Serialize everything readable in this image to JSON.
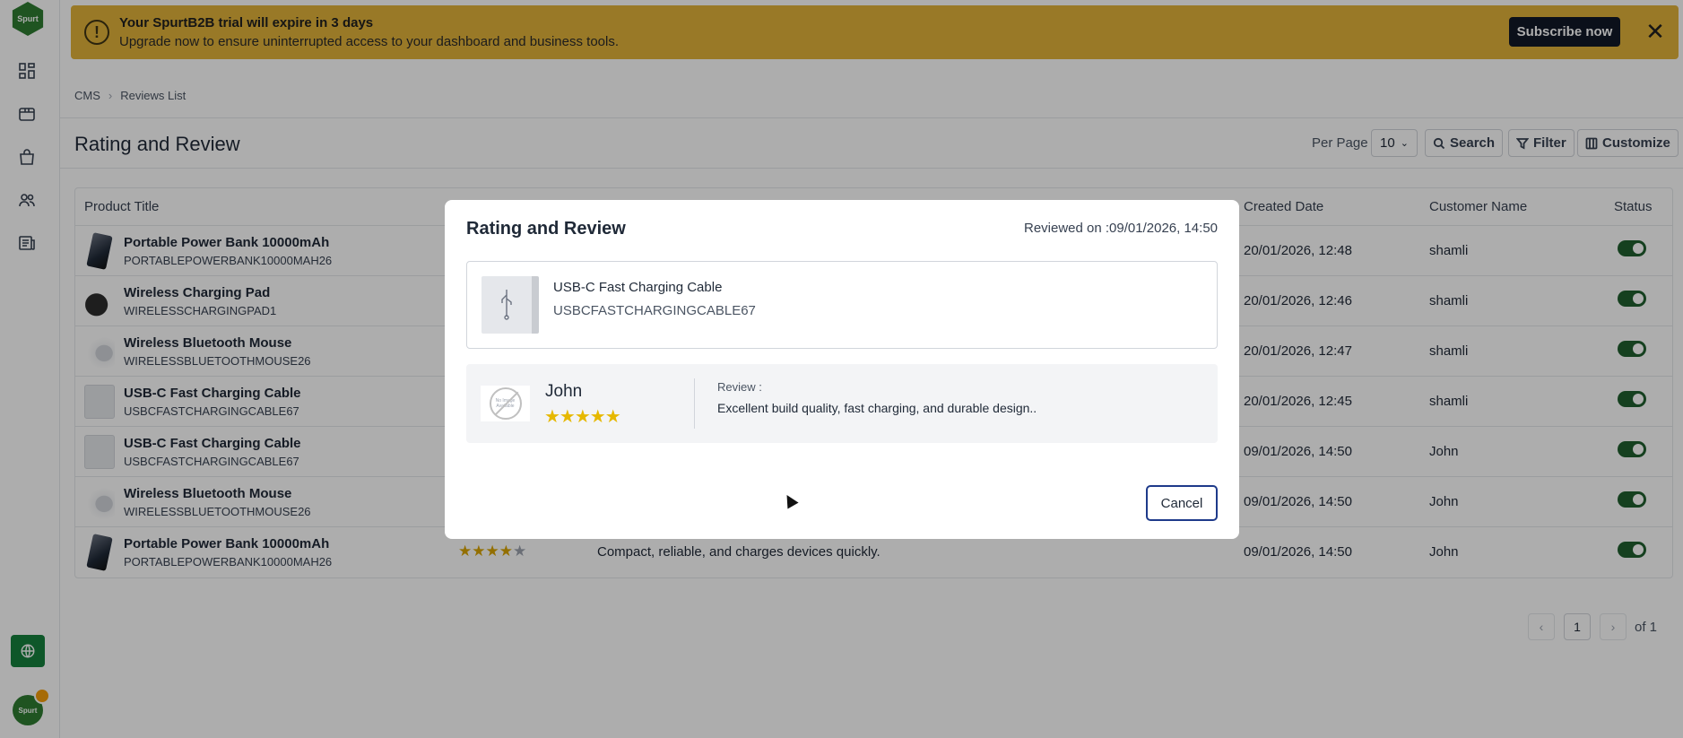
{
  "sidebar": {
    "logo_text": "Spurt",
    "items": [
      {
        "icon": "dashboard-icon"
      },
      {
        "icon": "box-icon"
      },
      {
        "icon": "shopping-bag-icon"
      },
      {
        "icon": "users-icon"
      },
      {
        "icon": "news-icon"
      }
    ],
    "globe_icon": "globe-icon",
    "avatar_text": "Spurt"
  },
  "banner": {
    "title": "Your SpurtB2B trial will expire in 3 days",
    "subtitle": "Upgrade now to ensure uninterrupted access to your dashboard and business tools.",
    "subscribe_label": "Subscribe now",
    "close_label": "✕",
    "warn_label": "!",
    "color": "#e2b33a"
  },
  "breadcrumb": {
    "items": [
      "CMS",
      "Reviews List"
    ],
    "separator": "›"
  },
  "page": {
    "title": "Rating and Review",
    "per_page_label": "Per Page",
    "per_page_value": "10",
    "search_label": "Search",
    "filter_label": "Filter",
    "customize_label": "Customize"
  },
  "table": {
    "headers": {
      "product": "Product Title",
      "created": "Created Date",
      "customer": "Customer Name",
      "status": "Status"
    },
    "rows": [
      {
        "name": "Portable Power Bank 10000mAh",
        "sku": "PORTABLEPOWERBANK10000MAH26",
        "date": "20/01/2026, 12:48",
        "customer": "shamli",
        "status": true
      },
      {
        "name": "Wireless Charging Pad",
        "sku": "WIRELESSCHARGINGPAD1",
        "date": "20/01/2026, 12:46",
        "customer": "shamli",
        "status": true
      },
      {
        "name": "Wireless Bluetooth Mouse",
        "sku": "WIRELESSBLUETOOTHMOUSE26",
        "date": "20/01/2026, 12:47",
        "customer": "shamli",
        "status": true
      },
      {
        "name": "USB-C Fast Charging Cable",
        "sku": "USBCFASTCHARGINGCABLE67",
        "date": "20/01/2026, 12:45",
        "customer": "shamli",
        "status": true
      },
      {
        "name": "USB-C Fast Charging Cable",
        "sku": "USBCFASTCHARGINGCABLE67",
        "date": "09/01/2026, 14:50",
        "customer": "John",
        "status": true
      },
      {
        "name": "Wireless Bluetooth Mouse",
        "sku": "WIRELESSBLUETOOTHMOUSE26",
        "date": "09/01/2026, 14:50",
        "customer": "John",
        "status": true
      },
      {
        "name": "Portable Power Bank 10000mAh",
        "sku": "PORTABLEPOWERBANK10000MAH26",
        "date": "09/01/2026, 14:50",
        "customer": "John",
        "status": true,
        "rating": 4,
        "review": "Compact, reliable, and charges devices quickly."
      }
    ],
    "star_full": "★★★★",
    "star_empty": "★"
  },
  "pagination": {
    "current": "1",
    "prev": "‹",
    "next": "›",
    "of_label": "of 1"
  },
  "modal": {
    "title": "Rating and Review",
    "reviewed_on": "Reviewed on :09/01/2026, 14:50",
    "product_name": "USB-C Fast Charging Cable",
    "product_sku": "USBCFASTCHARGINGCABLE67",
    "reviewer_name": "John",
    "rating": 5,
    "stars": "★★★★★",
    "review_label": "Review :",
    "review_text": "Excellent build quality, fast charging, and durable design..",
    "avatar_placeholder": "No Image Available",
    "cancel_label": "Cancel"
  }
}
